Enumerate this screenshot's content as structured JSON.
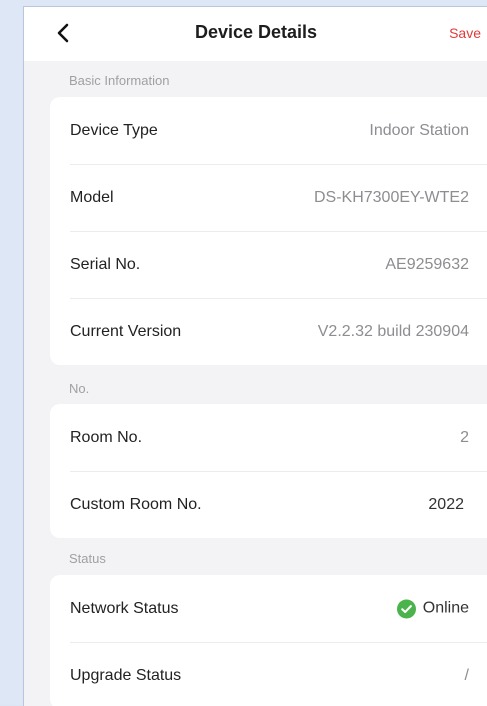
{
  "header": {
    "title": "Device Details",
    "save_label": "Save",
    "back_icon": "chevron-left-icon"
  },
  "sections": {
    "basic": {
      "label": "Basic Information",
      "rows": [
        {
          "label": "Device Type",
          "value": "Indoor Station"
        },
        {
          "label": "Model",
          "value": "DS-KH7300EY-WTE2"
        },
        {
          "label": "Serial No.",
          "value": "AE9259632"
        },
        {
          "label": "Current Version",
          "value": "V2.2.32 build 230904"
        }
      ]
    },
    "no": {
      "label": "No.",
      "rows": [
        {
          "label": "Room No.",
          "value": "2"
        },
        {
          "label": "Custom Room No.",
          "value": "2022"
        }
      ]
    },
    "status": {
      "label": "Status",
      "rows": [
        {
          "label": "Network Status",
          "value": "Online",
          "icon": "check-circle-icon"
        },
        {
          "label": "Upgrade Status",
          "value": "/"
        }
      ]
    }
  },
  "colors": {
    "accent_save": "#e03b3b",
    "online_green": "#4bb34b",
    "page_bg": "#f3f3f5"
  }
}
